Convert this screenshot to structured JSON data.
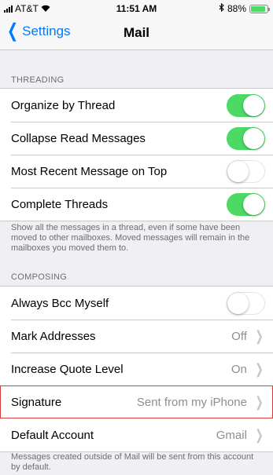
{
  "status_bar": {
    "carrier": "AT&T",
    "wifi_icon": "wifi-icon",
    "time": "11:51 AM",
    "bluetooth_icon": "bluetooth-icon",
    "battery_percent": "88%",
    "battery_level": 0.88,
    "battery_color": "#4cd964"
  },
  "nav": {
    "back_label": "Settings",
    "title": "Mail"
  },
  "threading": {
    "header": "THREADING",
    "rows": [
      {
        "label": "Organize by Thread",
        "on": true
      },
      {
        "label": "Collapse Read Messages",
        "on": true
      },
      {
        "label": "Most Recent Message on Top",
        "on": false
      },
      {
        "label": "Complete Threads",
        "on": true
      }
    ],
    "footer": "Show all the messages in a thread, even if some have been moved to other mailboxes. Moved messages will remain in the mailboxes you moved them to."
  },
  "composing": {
    "header": "COMPOSING",
    "always_bcc": {
      "label": "Always Bcc Myself",
      "on": false
    },
    "mark_addresses": {
      "label": "Mark Addresses",
      "value": "Off"
    },
    "increase_quote": {
      "label": "Increase Quote Level",
      "value": "On"
    },
    "signature": {
      "label": "Signature",
      "value": "Sent from my iPhone"
    },
    "default_account": {
      "label": "Default Account",
      "value": "Gmail"
    },
    "footer": "Messages created outside of Mail will be sent from this account by default."
  },
  "colors": {
    "accent": "#007aff",
    "toggle_on": "#4cd964",
    "highlight": "#d83a3a"
  }
}
